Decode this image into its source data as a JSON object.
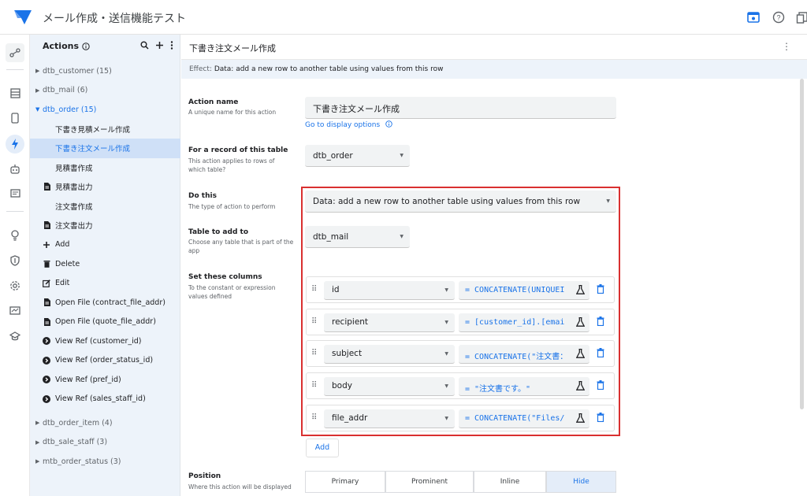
{
  "app": {
    "title": "メール作成・送信機能テスト"
  },
  "actions_panel": {
    "title": "Actions",
    "tree": [
      {
        "kind": "group",
        "label": "dtb_customer (15)",
        "open": false
      },
      {
        "kind": "group",
        "label": "dtb_mail (6)",
        "open": false
      },
      {
        "kind": "group",
        "label": "dtb_order (15)",
        "open": true
      },
      {
        "kind": "item",
        "label": "下書き見積メール作成",
        "icon": "none"
      },
      {
        "kind": "item",
        "label": "下書き注文メール作成",
        "icon": "none",
        "selected": true
      },
      {
        "kind": "item",
        "label": "見積書作成",
        "icon": "none"
      },
      {
        "kind": "item",
        "label": "見積書出力",
        "icon": "file-icon"
      },
      {
        "kind": "item",
        "label": "注文書作成",
        "icon": "none"
      },
      {
        "kind": "item",
        "label": "注文書出力",
        "icon": "file-icon"
      },
      {
        "kind": "item",
        "label": "Add",
        "icon": "plus-icon"
      },
      {
        "kind": "item",
        "label": "Delete",
        "icon": "trash-icon"
      },
      {
        "kind": "item",
        "label": "Edit",
        "icon": "edit-icon"
      },
      {
        "kind": "item",
        "label": "Open File (contract_file_addr)",
        "icon": "file-icon"
      },
      {
        "kind": "item",
        "label": "Open File (quote_file_addr)",
        "icon": "file-icon"
      },
      {
        "kind": "item",
        "label": "View Ref (customer_id)",
        "icon": "arrow-circle-icon"
      },
      {
        "kind": "item",
        "label": "View Ref (order_status_id)",
        "icon": "arrow-circle-icon"
      },
      {
        "kind": "item",
        "label": "View Ref (pref_id)",
        "icon": "arrow-circle-icon"
      },
      {
        "kind": "item",
        "label": "View Ref (sales_staff_id)",
        "icon": "arrow-circle-icon"
      },
      {
        "kind": "spacer"
      },
      {
        "kind": "group",
        "label": "dtb_order_item (4)",
        "open": false
      },
      {
        "kind": "group",
        "label": "dtb_sale_staff (3)",
        "open": false
      },
      {
        "kind": "group",
        "label": "mtb_order_status (3)",
        "open": false
      }
    ]
  },
  "main": {
    "title": "下書き注文メール作成",
    "effect_label": "Effect:",
    "effect_value": "Data: add a new row to another table using values from this row",
    "action_name": {
      "label": "Action name",
      "help": "A unique name for this action",
      "value": "下書き注文メール作成",
      "link": "Go to display options"
    },
    "for_table": {
      "label": "For a record of this table",
      "help": "This action applies to rows of which table?",
      "value": "dtb_order"
    },
    "do_this": {
      "label": "Do this",
      "help": "The type of action to perform",
      "value": "Data: add a new row to another table using values from this row"
    },
    "table_to_add": {
      "label": "Table to add to",
      "help": "Choose any table that is part of the app",
      "value": "dtb_mail"
    },
    "set_columns": {
      "label": "Set these columns",
      "help": "To the constant or expression values defined",
      "rows": [
        {
          "column": "id",
          "expression": "= CONCATENATE(UNIQUEI"
        },
        {
          "column": "recipient",
          "expression": "= [customer_id].[emai"
        },
        {
          "column": "subject",
          "expression": "= CONCATENATE(\"注文書："
        },
        {
          "column": "body",
          "expression": "= \"注文書です。\""
        },
        {
          "column": "file_addr",
          "expression": "= CONCATENATE(\"Files/"
        }
      ],
      "add_label": "Add"
    },
    "position": {
      "label": "Position",
      "help": "Where this action will be displayed",
      "options": [
        "Primary",
        "Prominent",
        "Inline",
        "Hide"
      ],
      "selected": "Hide"
    }
  },
  "colors": {
    "accent": "#1a73e8",
    "highlight": "#d93030",
    "panel_bg": "#edf3fa"
  }
}
